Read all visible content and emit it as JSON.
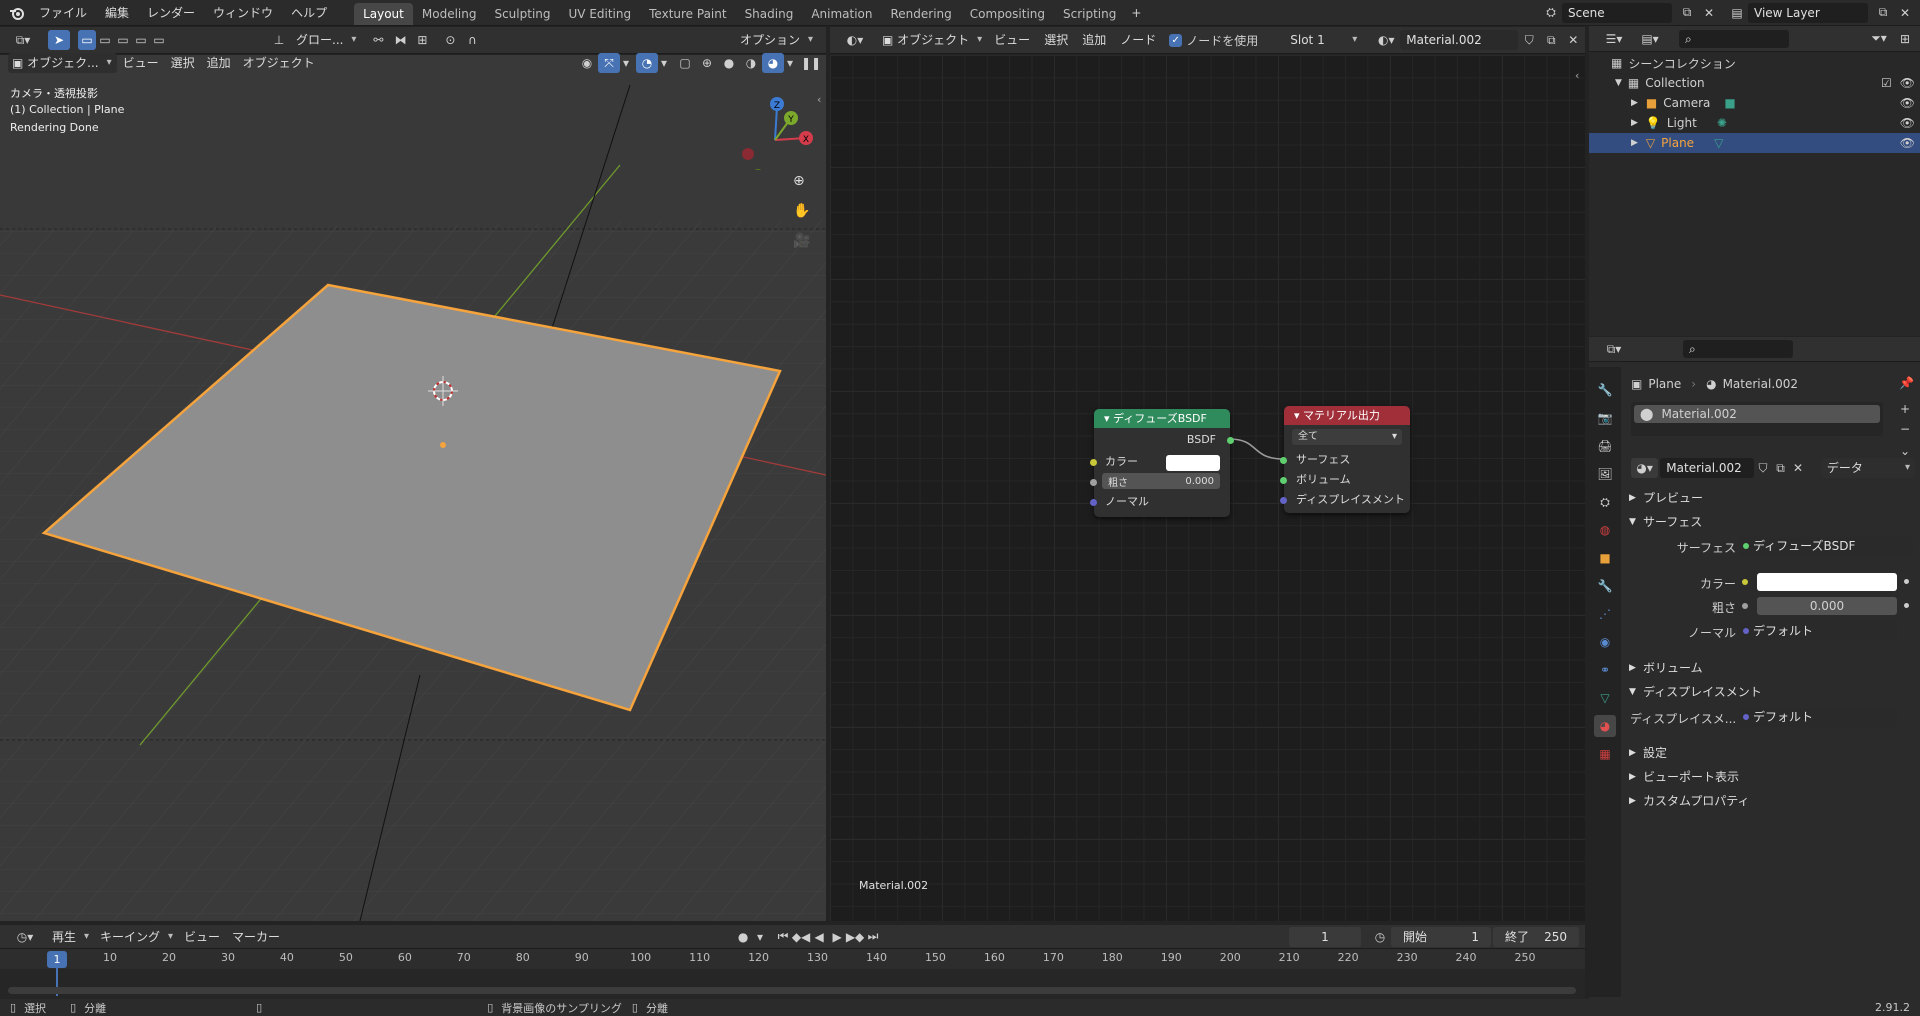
{
  "topbar": {
    "menus": [
      "ファイル",
      "編集",
      "レンダー",
      "ウィンドウ",
      "ヘルプ"
    ],
    "workspaces": [
      "Layout",
      "Modeling",
      "Sculpting",
      "UV Editing",
      "Texture Paint",
      "Shading",
      "Animation",
      "Rendering",
      "Compositing",
      "Scripting"
    ],
    "active_workspace": "Layout",
    "scene": "Scene",
    "view_layer": "View Layer"
  },
  "viewport": {
    "mode": "オブジェク...",
    "menus": [
      "ビュー",
      "選択",
      "追加",
      "オブジェクト"
    ],
    "transform": "グロー...",
    "options": "オプション",
    "info_line1": "カメラ・透視投影",
    "info_line2": "(1) Collection | Plane",
    "info_line3": "Rendering Done",
    "gizmo_x": "X",
    "gizmo_y": "Y",
    "gizmo_z": "Z"
  },
  "node_editor": {
    "mode": "オブジェクト",
    "menus": [
      "ビュー",
      "選択",
      "追加",
      "ノード"
    ],
    "use_nodes_label": "ノードを使用",
    "slot": "Slot 1",
    "material": "Material.002",
    "footer_label": "Material.002",
    "diffuse_node": {
      "title": "ディフューズBSDF",
      "output": "BSDF",
      "color_label": "カラー",
      "roughness_label": "粗さ",
      "roughness_value": "0.000",
      "normal_label": "ノーマル"
    },
    "output_node": {
      "title": "マテリアル出力",
      "target": "全て",
      "surface": "サーフェス",
      "volume": "ボリューム",
      "displacement": "ディスプレイスメント"
    }
  },
  "outliner": {
    "root": "シーンコレクション",
    "collection": "Collection",
    "items": [
      "Camera",
      "Light",
      "Plane"
    ],
    "selected": "Plane"
  },
  "properties": {
    "object": "Plane",
    "material": "Material.002",
    "slot_material": "Material.002",
    "data_dropdown": "データ",
    "sections": {
      "preview": "プレビュー",
      "surface": "サーフェス",
      "volume": "ボリューム",
      "displacement": "ディスプレイスメント",
      "settings": "設定",
      "viewport_display": "ビューポート表示",
      "custom_props": "カスタムプロパティ"
    },
    "surface_label": "サーフェス",
    "surface_value": "ディフューズBSDF",
    "color_label": "カラー",
    "roughness_label": "粗さ",
    "roughness_value": "0.000",
    "normal_label": "ノーマル",
    "normal_value": "デフォルト",
    "displacement_label": "ディスプレイスメ...",
    "displacement_value": "デフォルト"
  },
  "timeline": {
    "menus": [
      "再生",
      "キーイング",
      "ビュー",
      "マーカー"
    ],
    "current_frame": "1",
    "start_label": "開始",
    "start_value": "1",
    "end_label": "終了",
    "end_value": "250",
    "ticks": [
      "1",
      "10",
      "20",
      "30",
      "40",
      "50",
      "60",
      "70",
      "80",
      "90",
      "100",
      "110",
      "120",
      "130",
      "140",
      "150",
      "160",
      "170",
      "180",
      "190",
      "200",
      "210",
      "220",
      "230",
      "240",
      "250"
    ]
  },
  "statusbar": {
    "select": "選択",
    "split1": "分離",
    "bg_sample": "背景画像のサンプリング",
    "split2": "分離",
    "version": "2.91.2"
  },
  "colors": {
    "accent": "#4772b3",
    "selection_orange": "#f5a33c",
    "diffuse_header": "#2f8a5c",
    "output_header": "#a12f3a"
  }
}
